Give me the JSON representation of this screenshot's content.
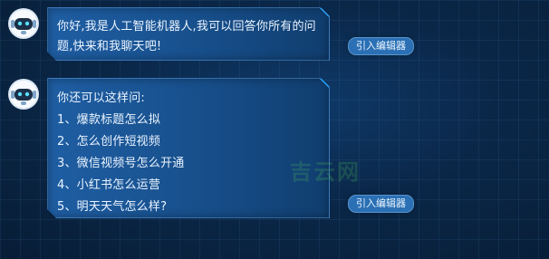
{
  "chat": {
    "bot_avatar_icon": "robot-avatar-icon",
    "messages": [
      {
        "text": "你好,我是人工智能机器人,我可以回答你所有的问题,快来和我聊天吧!",
        "button": "引入编辑器"
      },
      {
        "intro": "你还可以这样问:",
        "items": [
          "1、爆款标题怎么拟",
          "2、怎么创作短视频",
          "3、微信视频号怎么开通",
          "4、小红书怎么运营",
          "5、明天天气怎么样?"
        ],
        "button": "引入编辑器"
      }
    ]
  },
  "watermark": "吉云网",
  "colors": {
    "bubble_gradient_start": "#1f5ea3",
    "bubble_gradient_end": "#103d6e",
    "corner_accent": "#2aa7ff",
    "button_bg": "#2b6fb4",
    "page_bg": "#081d36"
  }
}
